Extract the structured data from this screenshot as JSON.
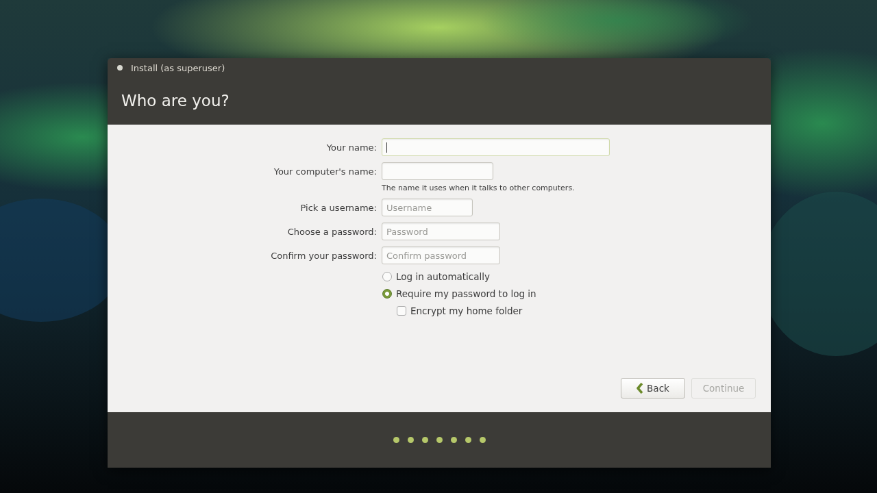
{
  "window": {
    "title": "Install (as superuser)",
    "heading": "Who are you?"
  },
  "fields": [
    {
      "label": "Your name:",
      "focused": true
    },
    {
      "label": "Your computer's name:",
      "focused": false,
      "hint": "The name it uses when it talks to other computers."
    },
    {
      "label": "Pick a username:",
      "placeholder": "Username",
      "focused": false
    },
    {
      "label": "Choose a password:",
      "placeholder": "Password",
      "focused": false
    },
    {
      "label": "Confirm your password:",
      "placeholder": "Confirm password",
      "focused": false
    }
  ],
  "options": [
    {
      "kind": "radio",
      "label": "Log in automatically",
      "selected": false
    },
    {
      "kind": "radio",
      "label": "Require my password to log in",
      "selected": true
    },
    {
      "kind": "checkbox",
      "label": "Encrypt my home folder",
      "checked": false
    }
  ],
  "buttons": [
    {
      "kind": "back",
      "label": "Back",
      "disabled": false
    },
    {
      "kind": "plain",
      "label": "Continue",
      "disabled": true
    }
  ]
}
